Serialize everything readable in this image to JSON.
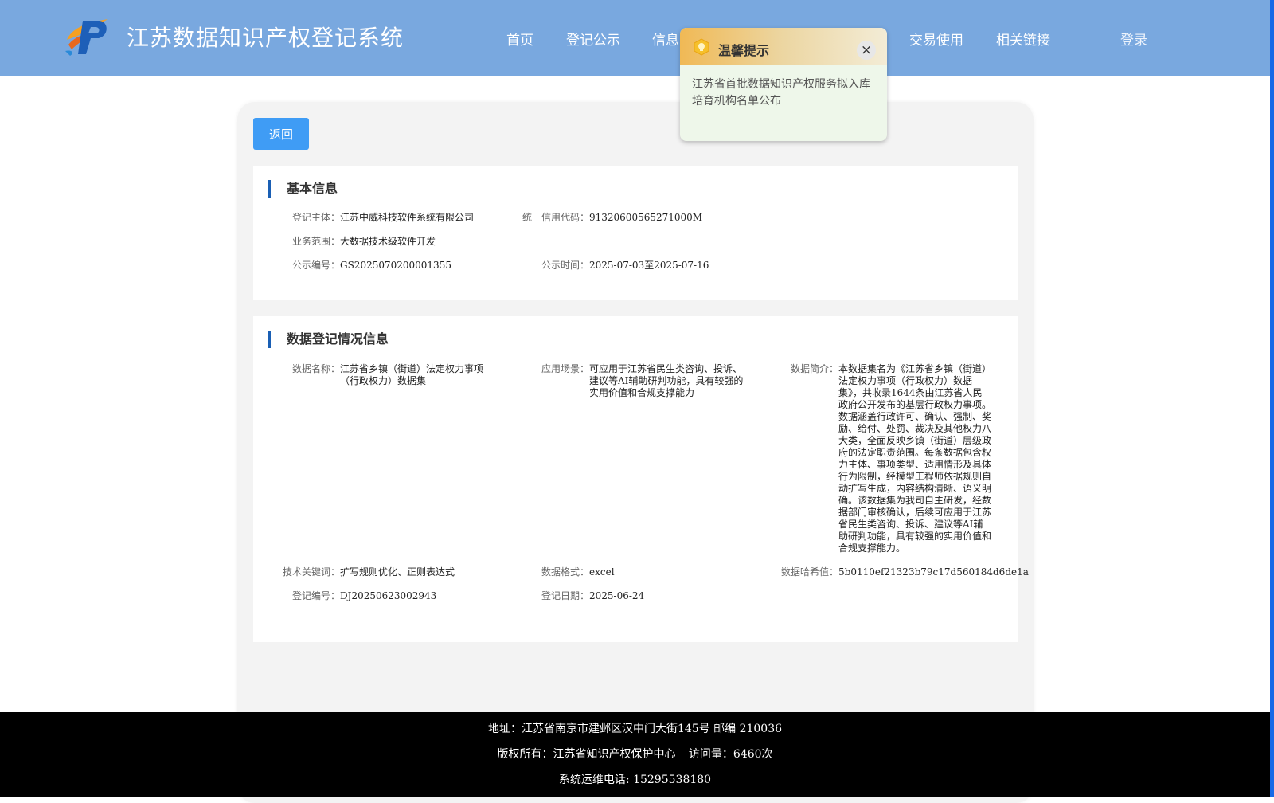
{
  "header": {
    "title": "江苏数据知识产权登记系统",
    "nav": [
      {
        "label": "首页"
      },
      {
        "label": "登记公示"
      },
      {
        "label": "信息"
      },
      {
        "label": "交易使用"
      },
      {
        "label": "相关链接"
      }
    ],
    "login_label": "登录"
  },
  "back_label": "返回",
  "basic_info": {
    "title": "基本信息",
    "subject_label": "登记主体：",
    "subject_value": "江苏中威科技软件系统有限公司",
    "credit_label": "统一信用代码：",
    "credit_value": "91320600565271000M",
    "scope_label": "业务范围：",
    "scope_value": "大数据技术级软件开发",
    "notice_no_label": "公示编号：",
    "notice_no_value": "GS2025070200001355",
    "notice_time_label": "公示时间：",
    "notice_time_value": "2025-07-03至2025-07-16"
  },
  "data_info": {
    "title": "数据登记情况信息",
    "name_label": "数据名称：",
    "name_value": "江苏省乡镇（街道）法定权力事项（行政权力）数据集",
    "scene_label": "应用场景：",
    "scene_value": "可应用于江苏省民生类咨询、投诉、建议等AI辅助研判功能，具有较强的实用价值和合规支撑能力",
    "intro_label": "数据简介：",
    "intro_value": "本数据集名为《江苏省乡镇（街道）法定权力事项（行政权力）数据集》，共收录1644条由江苏省人民政府公开发布的基层行政权力事项。数据涵盖行政许可、确认、强制、奖励、给付、处罚、裁决及其他权力八大类，全面反映乡镇（街道）层级政府的法定职责范围。每条数据包含权力主体、事项类型、适用情形及具体行为限制，经模型工程师依据规则自动扩写生成，内容结构清晰、语义明确。该数据集为我司自主研发，经数据部门审核确认，后续可应用于江苏省民生类咨询、投诉、建议等AI辅助研判功能，具有较强的实用价值和合规支撑能力。",
    "keyword_label": "技术关键词：",
    "keyword_value": "扩写规则优化、正则表达式",
    "format_label": "数据格式：",
    "format_value": "excel",
    "hash_label": "数据哈希值：",
    "hash_value": "5b0110ef21323b79c17d560184d6de1a",
    "reg_no_label": "登记编号：",
    "reg_no_value": "DJ20250623002943",
    "reg_date_label": "登记日期：",
    "reg_date_value": "2025-06-24"
  },
  "popup": {
    "title": "温馨提示",
    "text": "江苏省首批数据知识产权服务拟入库培育机构名单公布",
    "close_glyph": "×",
    "icon": "lightbulb-icon"
  },
  "footer": {
    "address": "地址：江苏省南京市建邺区汉中门大街145号 邮编 210036",
    "copyright": "版权所有：江苏省知识产权保护中心",
    "visits": "访问量：6460次",
    "phone": "系统运维电话: 15295538180"
  },
  "colors": {
    "header_bg": "#79a8df",
    "button": "#3f9cf5",
    "accent_bar": "#1a5fb4",
    "footer_bg": "#000000"
  }
}
